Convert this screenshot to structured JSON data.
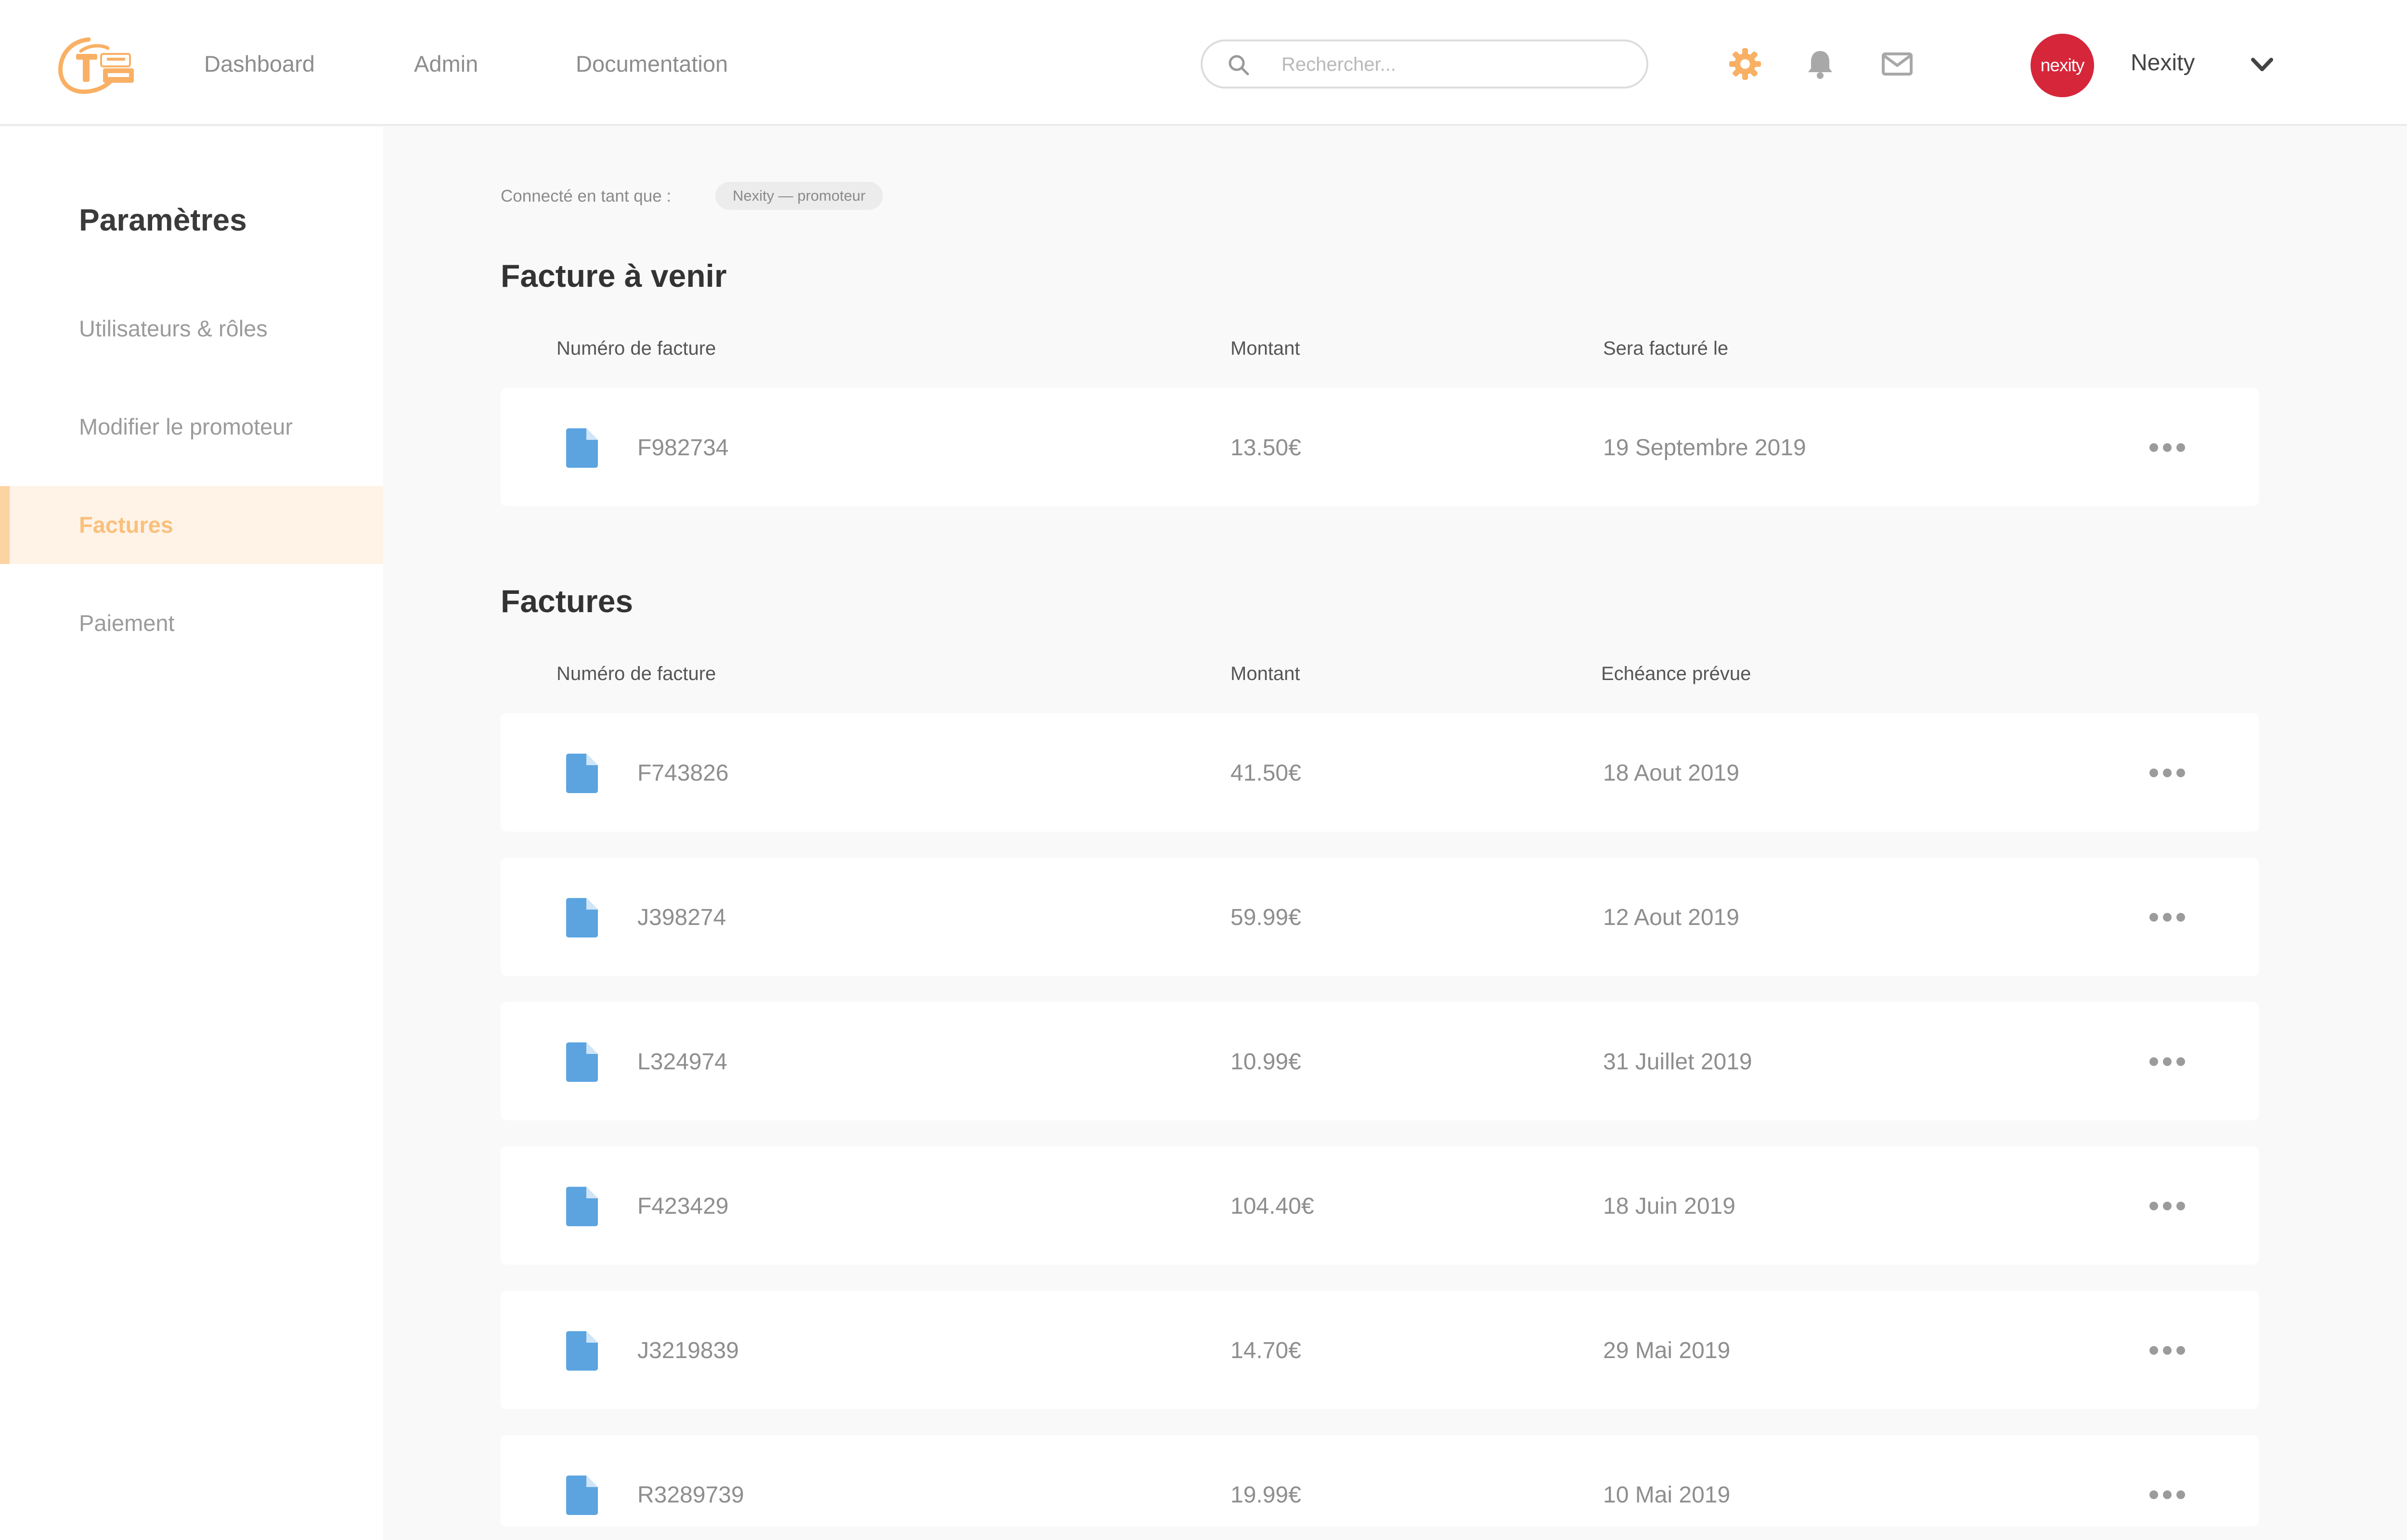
{
  "header": {
    "logo_icon": "realtyx-logo-icon",
    "nav": [
      "Dashboard",
      "Admin",
      "Documentation"
    ],
    "search": {
      "placeholder": "Rechercher...",
      "value": "",
      "icon": "search-icon"
    },
    "icons": [
      "gear-icon",
      "bell-icon",
      "mail-icon"
    ],
    "avatar_text": "nexity",
    "avatar_color": "#d6263a",
    "user_name": "Nexity",
    "dropdown_icon": "chevron-down-icon",
    "accent_color": "#f9b064"
  },
  "sidebar": {
    "title": "Paramètres",
    "items": [
      {
        "label": "Utilisateurs & rôles",
        "active": false
      },
      {
        "label": "Modifier le promoteur",
        "active": false
      },
      {
        "label": "Factures",
        "active": true
      },
      {
        "label": "Paiement",
        "active": false
      }
    ],
    "active_color": "#f9c07c"
  },
  "main": {
    "connected_label": "Connecté en tant que :",
    "connected_role": "Nexity — promoteur",
    "upcoming": {
      "title": "Facture à venir",
      "columns": [
        "Numéro de facture",
        "Montant",
        "Sera facturé le"
      ],
      "rows": [
        {
          "number": "F982734",
          "amount": "13.50€",
          "date": "19 Septembre 2019"
        }
      ]
    },
    "invoices": {
      "title": "Factures",
      "columns": [
        "Numéro de facture",
        "Montant",
        "Echéance prévue"
      ],
      "rows": [
        {
          "number": "F743826",
          "amount": "41.50€",
          "date": "18 Aout 2019"
        },
        {
          "number": "J398274",
          "amount": "59.99€",
          "date": "12 Aout 2019"
        },
        {
          "number": "L324974",
          "amount": "10.99€",
          "date": "31 Juillet 2019"
        },
        {
          "number": "F423429",
          "amount": "104.40€",
          "date": "18 Juin 2019"
        },
        {
          "number": "J3219839",
          "amount": "14.70€",
          "date": "29 Mai 2019"
        },
        {
          "number": "R3289739",
          "amount": "19.99€",
          "date": "10 Mai 2019"
        }
      ]
    },
    "row_icon": "document-icon",
    "row_icon_color": "#5ba4e0",
    "row_action_icon": "more-horizontal-icon"
  }
}
